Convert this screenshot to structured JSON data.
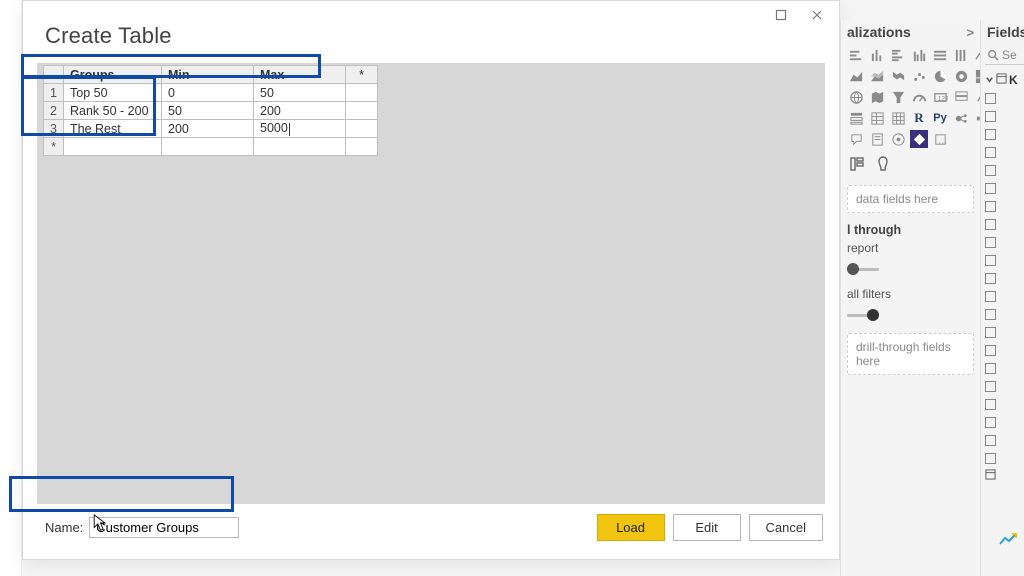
{
  "dialog": {
    "title": "Create Table",
    "name_label": "Name:",
    "name_value": "Customer Groups",
    "buttons": {
      "load": "Load",
      "edit": "Edit",
      "cancel": "Cancel"
    },
    "star": "*"
  },
  "table": {
    "headers": {
      "groups": "Groups",
      "min": "Min",
      "max": "Max"
    },
    "rows": [
      {
        "n": "1",
        "groups": "Top 50",
        "min": "0",
        "max": "50"
      },
      {
        "n": "2",
        "groups": "Rank 50 - 200",
        "min": "50",
        "max": "200"
      },
      {
        "n": "3",
        "groups": "The Rest",
        "min": "200",
        "max": "5000"
      }
    ],
    "new_row_star": "*"
  },
  "viz": {
    "title": "alizations",
    "chevron": ">",
    "fieldwell_placeholder": "data fields here",
    "drill_title": "l through",
    "cross_label": "report",
    "filters_label": "all filters",
    "drill_placeholder": "drill-through fields here",
    "r_label": "R",
    "py_label": "Py"
  },
  "fields": {
    "title": "Fields",
    "search_placeholder": "Se",
    "table_label": "K"
  },
  "chart_data": {
    "type": "table",
    "columns": [
      "Groups",
      "Min",
      "Max"
    ],
    "rows": [
      [
        "Top 50",
        0,
        50
      ],
      [
        "Rank 50 - 200",
        50,
        200
      ],
      [
        "The Rest",
        200,
        5000
      ]
    ],
    "title": "Create Table",
    "name": "Customer Groups"
  }
}
